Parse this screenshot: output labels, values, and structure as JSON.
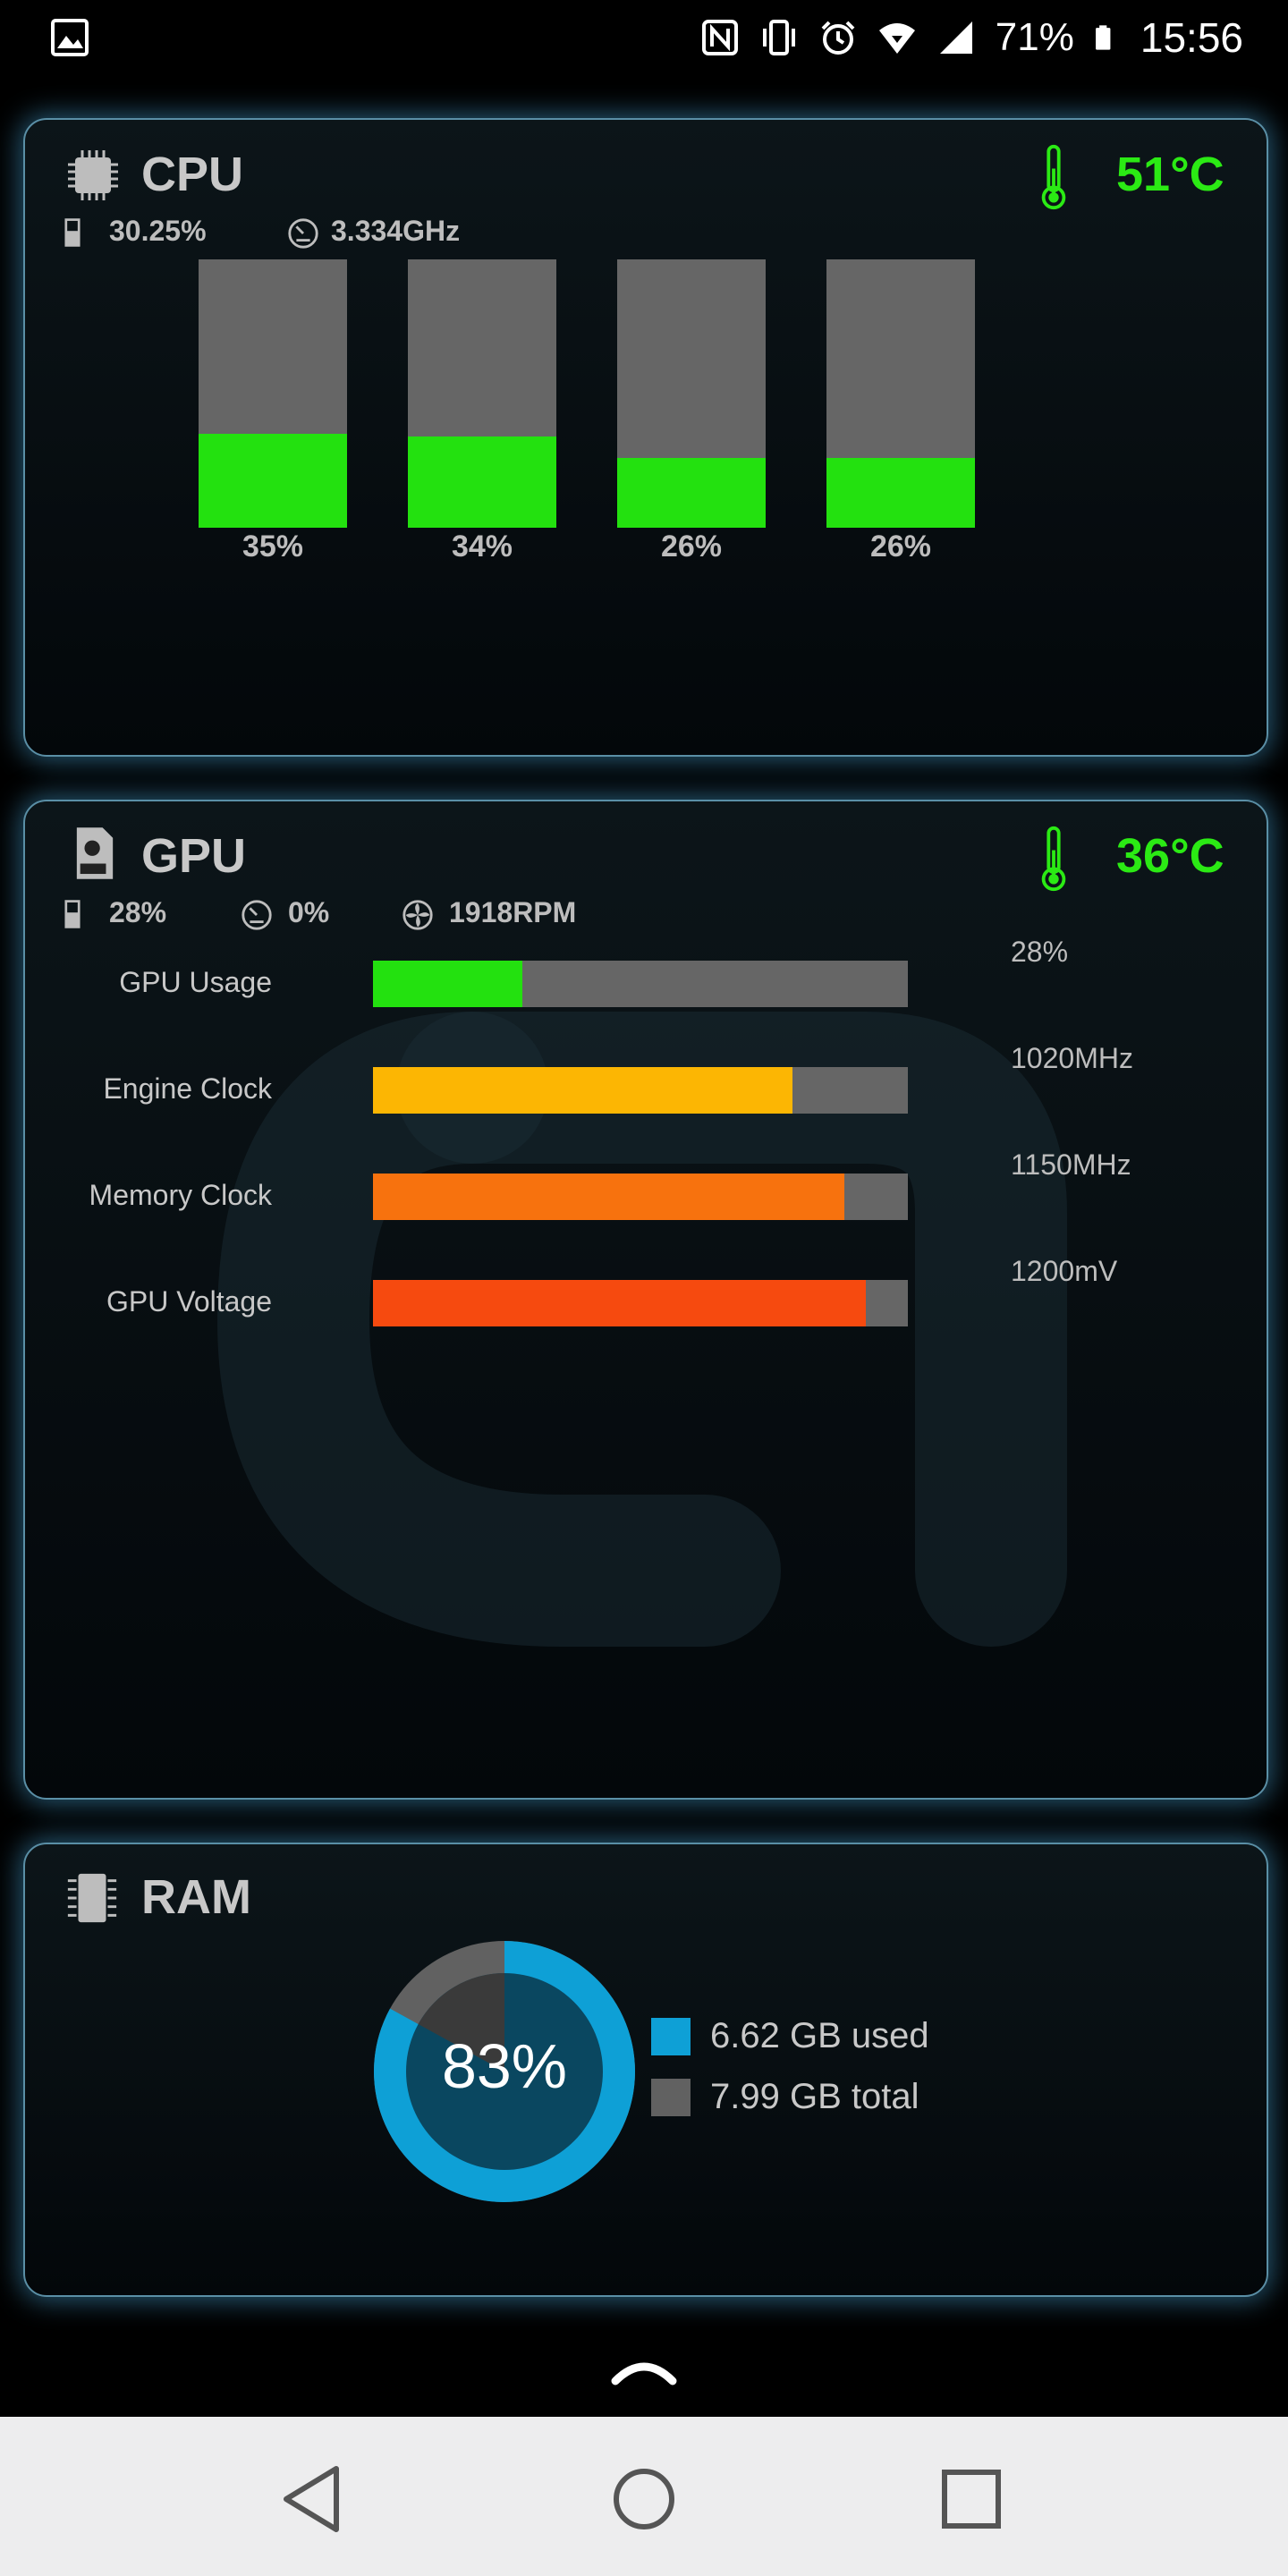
{
  "status_bar": {
    "battery_percent": "71%",
    "time": "15:56",
    "icons": [
      "image-icon",
      "nfc-icon",
      "vibrate-icon",
      "alarm-icon",
      "wifi-icon",
      "signal-icon",
      "battery-icon"
    ]
  },
  "cpu": {
    "title": "CPU",
    "temperature": "51°C",
    "usage": "30.25%",
    "frequency": "3.334GHz",
    "cores": [
      {
        "label": "35%",
        "value": 35
      },
      {
        "label": "34%",
        "value": 34
      },
      {
        "label": "26%",
        "value": 26
      },
      {
        "label": "26%",
        "value": 26
      }
    ]
  },
  "gpu": {
    "title": "GPU",
    "temperature": "36°C",
    "usage": "28%",
    "load": "0%",
    "fan": "1918RPM",
    "rows": [
      {
        "label": "GPU Usage",
        "value": "28%",
        "fill": 0.28,
        "color": "#23e10f"
      },
      {
        "label": "Engine Clock",
        "value": "1020MHz",
        "fill": 0.785,
        "color": "#fcb603"
      },
      {
        "label": "Memory Clock",
        "value": "1150MHz",
        "fill": 0.882,
        "color": "#f7720e"
      },
      {
        "label": "GPU Voltage",
        "value": "1200mV",
        "fill": 0.922,
        "color": "#f64a0f"
      }
    ]
  },
  "ram": {
    "title": "RAM",
    "percent_label": "83%",
    "percent": 83,
    "used": "6.62 GB used",
    "total": "7.99 GB total",
    "used_color": "#0ea0d6",
    "total_color": "#616161"
  },
  "colors": {
    "accent_green": "#2bea14",
    "panel_glow": "#46a0d2"
  },
  "nav": {
    "back_icon": "back-triangle-icon",
    "home_icon": "home-circle-icon",
    "recents_icon": "recents-square-icon"
  }
}
